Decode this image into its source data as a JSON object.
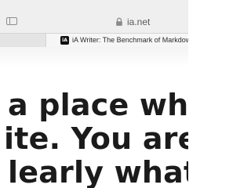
{
  "browser": {
    "address": "ia.net",
    "tab_favicon": "iA",
    "tab_title": "iA Writer: The Benchmark of Markdown Writing Apps"
  },
  "page": {
    "hero_lines": [
      "a place wher",
      "ite. You are fu",
      "learly what yo"
    ]
  },
  "icons": {
    "sidebar": "sidebar-icon",
    "lock": "lock-icon"
  },
  "colors": {
    "toolbar": "#efefef",
    "tab_active": "#f6f6f6",
    "text": "#1b1b1b"
  }
}
